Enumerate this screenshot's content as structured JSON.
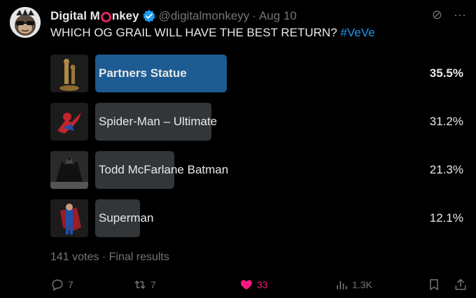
{
  "tweet": {
    "display_name_part1": "Digital M",
    "display_name_part2": "nkey",
    "handle": "@digitalmonkeyy",
    "separator": "·",
    "date": "Aug 10",
    "text": "WHICH OG GRAIL WILL HAVE THE BEST RETURN?",
    "hashtag": "#VeVe",
    "verified_color": "#1d9bf0",
    "logo_ring_color": "#e0245e"
  },
  "top_icons": [
    "grok-icon",
    "more-icon"
  ],
  "top_icon_glyphs": {
    "grok": "⊘",
    "more": "···"
  },
  "poll": {
    "options": [
      {
        "label": "Partners Statue",
        "percent_text": "35.5%",
        "percent": 35.5,
        "winner": true,
        "thumb": "partners-statue-thumbnail"
      },
      {
        "label": "Spider-Man – Ultimate",
        "percent_text": "31.2%",
        "percent": 31.2,
        "winner": false,
        "thumb": "spider-man-thumbnail"
      },
      {
        "label": "Todd McFarlane Batman",
        "percent_text": "21.3%",
        "percent": 21.3,
        "winner": false,
        "thumb": "batman-thumbnail"
      },
      {
        "label": "Superman",
        "percent_text": "12.1%",
        "percent": 12.1,
        "winner": false,
        "thumb": "superman-thumbnail"
      }
    ],
    "votes_text": "141 votes",
    "separator": "·",
    "status": "Final results",
    "winner_color": "#1d5b92",
    "bar_color": "#333639"
  },
  "actions": {
    "replies": "7",
    "reposts": "7",
    "likes": "33",
    "views": "1.3K",
    "like_color": "#f91880"
  }
}
